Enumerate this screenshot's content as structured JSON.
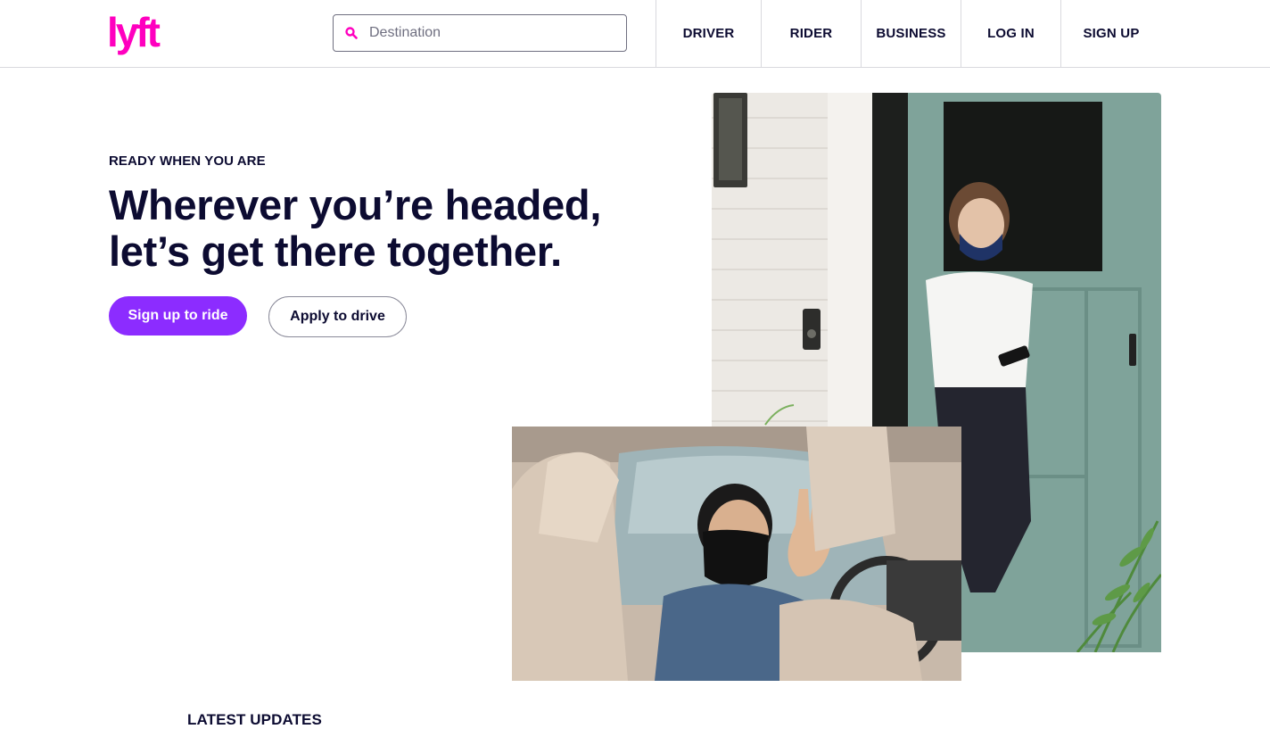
{
  "header": {
    "logo_text": "lyft",
    "search": {
      "placeholder": "Destination",
      "value": ""
    },
    "nav": [
      {
        "label": "DRIVER"
      },
      {
        "label": "RIDER"
      },
      {
        "label": "BUSINESS"
      },
      {
        "label": "LOG IN"
      },
      {
        "label": "SIGN UP"
      }
    ]
  },
  "hero": {
    "eyebrow": "READY WHEN YOU ARE",
    "headline_line1": "Wherever you’re headed,",
    "headline_line2": "let’s get there together.",
    "primary_button": "Sign up to ride",
    "secondary_button": "Apply to drive"
  },
  "photos": {
    "door_photo": "woman-in-mask-leaving-house",
    "car_photo": "driver-in-mask-waving"
  },
  "section": {
    "latest_updates": "LATEST UPDATES"
  },
  "colors": {
    "brand_pink": "#ff00bf",
    "primary_purple": "#8c2cff",
    "text_navy": "#0c0b31"
  }
}
